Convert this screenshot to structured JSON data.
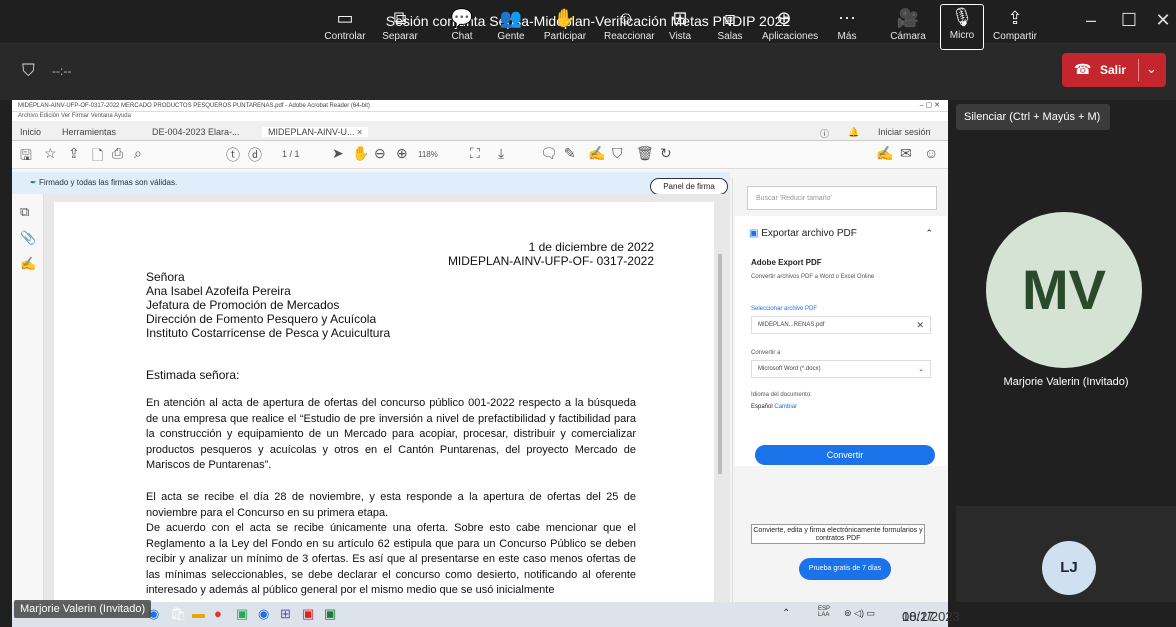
{
  "window": {
    "title": "Sesión conjunta Sepsa-Mideplan-Verificación Metas PNDIP 2022"
  },
  "meeting": {
    "timer": "--:--"
  },
  "toolbar": [
    {
      "label": "Controlar",
      "icon": "▭"
    },
    {
      "label": "Separar",
      "icon": "⧉"
    },
    {
      "label": "Chat",
      "icon": "💬"
    },
    {
      "label": "Gente",
      "icon": "👥"
    },
    {
      "label": "Participar",
      "icon": "✋"
    },
    {
      "label": "Reaccionar",
      "icon": "☺"
    },
    {
      "label": "Vista",
      "icon": "⊞"
    },
    {
      "label": "Salas",
      "icon": "⧈"
    },
    {
      "label": "Aplicaciones",
      "icon": "⊕"
    },
    {
      "label": "Más",
      "icon": "⋯"
    },
    {
      "label": "Cámara",
      "icon": "🎥"
    },
    {
      "label": "Micro",
      "icon": "🎙"
    },
    {
      "label": "Compartir",
      "icon": "⇪"
    }
  ],
  "leave": {
    "label": "Salir"
  },
  "tooltip": "Silenciar (Ctrl + Mayús + M)",
  "acrobat": {
    "title": "MIDEPLAN-AINV-UFP-OF-0317-2022 MERCADO PRODUCTOS PESQUEROS PUNTARENAS.pdf - Adobe Acrobat Reader (64-bit)",
    "menu": "Archivo  Edición  Ver  Firmar  Ventana  Ayuda",
    "tabs": [
      "Inicio",
      "Herramientas",
      "DE-004-2023 Elara-...",
      "MIDEPLAN-AINV-U... ×"
    ],
    "signin": "Iniciar sesión",
    "page_indicator": "1 / 1",
    "zoom": "118%",
    "signature_msg": "Firmado y todas las firmas son válidas.",
    "panel_btn": "Panel de firma"
  },
  "document": {
    "date": "1 de diciembre de 2022",
    "ref": "MIDEPLAN-AINV-UFP-OF- 0317-2022",
    "addr": [
      "Señora",
      "Ana Isabel Azofeifa Pereira",
      "Jefatura de Promoción de Mercados",
      "Dirección de Fomento Pesquero y Acuícola",
      "Instituto Costarricense de Pesca y Acuicultura"
    ],
    "greeting": "Estimada señora:",
    "p1": "En atención al acta de apertura de ofertas del concurso público 001-2022 respecto a la búsqueda de una empresa que realice el “Estudio de pre inversión a nivel de prefactibilidad y factibilidad para la construcción y equipamiento de un Mercado para acopiar, procesar, distribuir y comercializar productos pesqueros y acuícolas y otros en el Cantón Puntarenas, del proyecto Mercado de Mariscos de Puntarenas”.",
    "p2": "El acta se recibe el día 28 de noviembre, y esta responde a la apertura de ofertas del 25 de noviembre para el Concurso en su primera etapa.",
    "p3": "De acuerdo con el acta se recibe únicamente una oferta.  Sobre esto cabe mencionar que el Reglamento a la Ley del Fondo en su artículo 62 estipula que para un Concurso Público se deben recibir y analizar un mínimo de 3 ofertas. Es así que al presentarse en este caso menos ofertas de las mínimas seleccionables, se debe declarar el concurso como desierto, notificando al oferente interesado y además al público general por el mismo medio que se usó inicialmente"
  },
  "export_panel": {
    "search_placeholder": "Buscar 'Reducir tamaño'",
    "header": "Exportar archivo PDF",
    "title": "Adobe Export PDF",
    "desc": "Convertir archivos PDF a Word o Excel Online",
    "select_label": "Seleccionar archivo PDF",
    "file": "MIDEPLAN...RENAS.pdf",
    "convert_to": "Convertir a",
    "format": "Microsoft Word (*.docx)",
    "lang_label": "Idioma del documento:",
    "lang": "Español",
    "lang_change": "Cambiar",
    "convert_btn": "Convertir",
    "promo": "Convierte, edita y firma electrónicamente formularios y contratos PDF",
    "trial": "Prueba gratis de 7 días"
  },
  "participants": [
    {
      "initials": "MV",
      "name": "Marjorie Valerin (Invitado)"
    },
    {
      "initials": "LJ"
    }
  ],
  "presenter_label": "Marjorie Valerin (Invitado)",
  "tray": {
    "lang": "ESP\nLAA",
    "time": "08:27",
    "date": "10/1/2023"
  }
}
